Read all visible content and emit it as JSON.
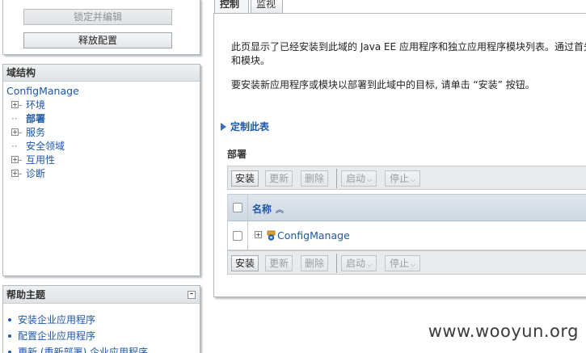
{
  "change_center": {
    "lock_edit_label": "锁定并编辑",
    "release_config_label": "释放配置"
  },
  "domain_tree": {
    "title": "域结构",
    "root": "ConfigManage",
    "items": [
      {
        "label": "环境",
        "expandable": true,
        "bold": false
      },
      {
        "label": "部署",
        "expandable": false,
        "bold": true
      },
      {
        "label": "服务",
        "expandable": true,
        "bold": false
      },
      {
        "label": "安全领域",
        "expandable": false,
        "bold": false
      },
      {
        "label": "互用性",
        "expandable": true,
        "bold": false
      },
      {
        "label": "诊断",
        "expandable": true,
        "bold": false
      }
    ]
  },
  "help": {
    "title": "帮助主题",
    "links": [
      "安装企业应用程序",
      "配置企业应用程序",
      "更新 (重新部署) 企业应用程序"
    ]
  },
  "tabs": {
    "control": "控制",
    "monitor": "监视"
  },
  "main": {
    "description_line1": "此页显示了已经安装到此域的 Java EE 应用程序和独立应用程序模块列表。通过首先",
    "description_line2": "和模块。",
    "description_install": "要安装新应用程序或模块以部署到此域中的目标, 请单击 “安装” 按钮。",
    "customize_table": "定制此表",
    "section_title": "部署"
  },
  "toolbar": {
    "install": "安装",
    "update": "更新",
    "delete": "删除",
    "start": "启动",
    "stop": "停止"
  },
  "table": {
    "column_name": "名称",
    "sort_indicator": "ascending",
    "rows": [
      {
        "name": "ConfigManage"
      }
    ]
  },
  "watermark": "www.wooyun.org",
  "colors": {
    "link": "#1c57a8",
    "header_bg": "#dfe6ee"
  }
}
